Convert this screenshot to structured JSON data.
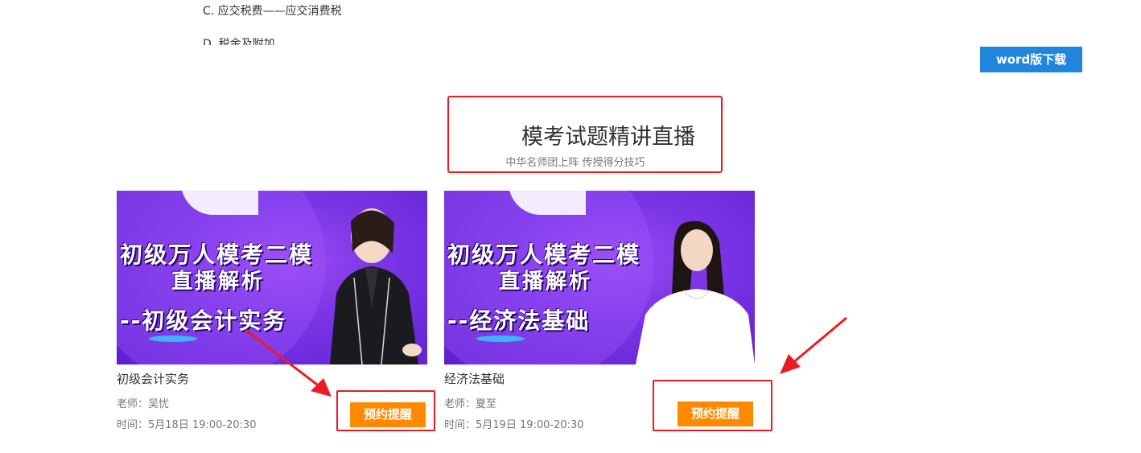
{
  "question_options": {
    "option_c": "C. 应交税费——应交消费税",
    "option_d": "D. 税金及附加"
  },
  "download_button": "word版下载",
  "live_section": {
    "title": "模考试题精讲直播",
    "subtitle": "中华名师团上阵 传授得分技巧"
  },
  "cards": [
    {
      "banner_line1": "初级万人模考二模",
      "banner_line2": "直播解析",
      "banner_line3": "--初级会计实务",
      "course": "初级会计实务",
      "teacher": "老师：吴忧",
      "time": "时间：5月18日 19:00-20:30",
      "button": "预约提醒"
    },
    {
      "banner_line1": "初级万人模考二模",
      "banner_line2": "直播解析",
      "banner_line3": "--经济法基础",
      "course": "经济法基础",
      "teacher": "老师：夏至",
      "time": "时间：5月19日 19:00-20:30",
      "button": "预约提醒"
    }
  ],
  "colors": {
    "accent_blue": "#1f85dd",
    "button_orange": "#ff8a00",
    "annotation_red": "#ec1b23",
    "banner_purple": "#7b35e6"
  }
}
